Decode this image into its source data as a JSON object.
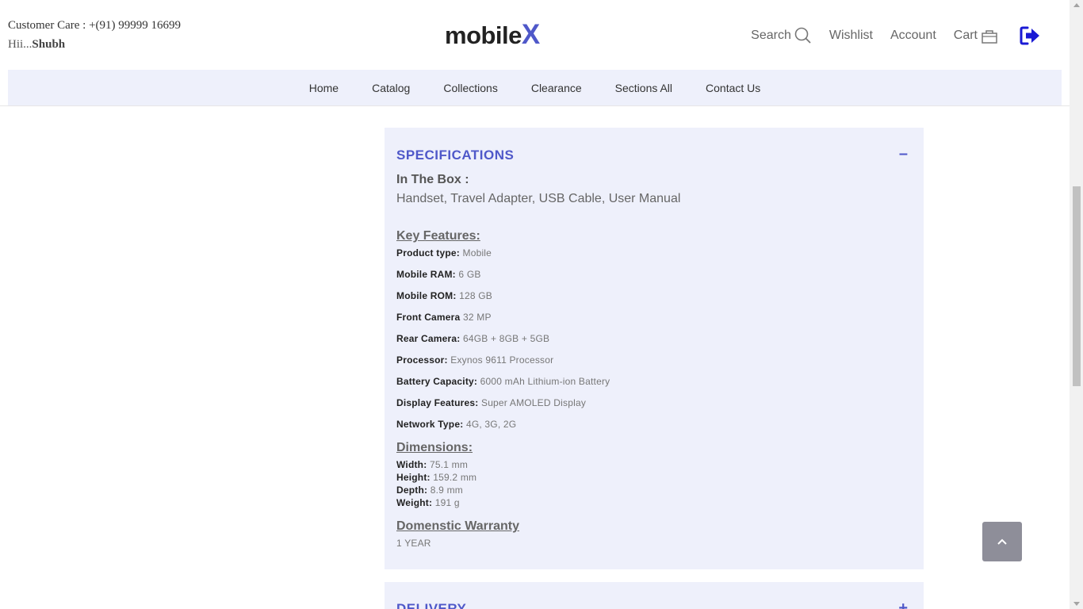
{
  "header": {
    "customer_care": "Customer Care : +(91) 99999 16699",
    "greeting_prefix": "Hii...",
    "user_name": "Shubh",
    "logo_main": "mobile",
    "logo_accent": "X",
    "search_label": "Search",
    "wishlist_label": "Wishlist",
    "account_label": "Account",
    "cart_label": "Cart",
    "accent_color": "#4f58c9",
    "logout_icon_color": "#1a1ad4"
  },
  "nav": {
    "items": [
      "Home",
      "Catalog",
      "Collections",
      "Clearance",
      "Sections All",
      "Contact Us"
    ]
  },
  "specifications": {
    "title": "SPECIFICATIONS",
    "toggle": "–",
    "in_the_box_label": "In The Box :",
    "in_the_box_value": "Handset, Travel Adapter, USB Cable, User Manual",
    "key_features_title": "Key Features:",
    "features": [
      {
        "label": "Product type:",
        "value": "Mobile"
      },
      {
        "label": "Mobile RAM:",
        "value": "6 GB"
      },
      {
        "label": "Mobile ROM:",
        "value": "128 GB"
      },
      {
        "label": "Front Camera",
        "value": "32 MP"
      },
      {
        "label": "Rear Camera:",
        "value": "64GB + 8GB + 5GB"
      },
      {
        "label": "Processor:",
        "value": "Exynos 9611 Processor"
      },
      {
        "label": "Battery Capacity:",
        "value": "6000 mAh Lithium-ion Battery"
      },
      {
        "label": "Display Features:",
        "value": "Super AMOLED Display"
      },
      {
        "label": "Network Type:",
        "value": "4G, 3G, 2G"
      }
    ],
    "dimensions_title": "Dimensions:",
    "dimensions": [
      {
        "label": "Width:",
        "value": "75.1 mm"
      },
      {
        "label": "Height:",
        "value": "159.2 mm"
      },
      {
        "label": "Depth:",
        "value": "8.9 mm"
      },
      {
        "label": "Weight:",
        "value": "191 g"
      }
    ],
    "warranty_title": "Domenstic Warranty",
    "warranty_value": "1 YEAR"
  },
  "delivery": {
    "title": "DELIVERY",
    "toggle": "+"
  },
  "icons": {
    "search": "search-icon",
    "cart": "cart-icon",
    "logout": "logout-icon",
    "back_to_top": "chevron-up-icon"
  }
}
